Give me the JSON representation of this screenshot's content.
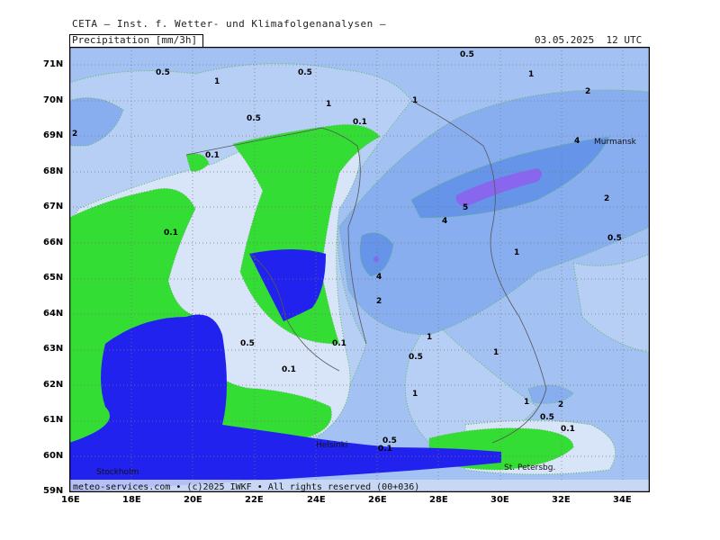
{
  "header": {
    "title": "CETA — Inst. f. Wetter- und Klimafolgenanalysen —",
    "parameter": "Precipitation [mm/3h]",
    "valid_time": "03.05.2025  12 UTC"
  },
  "footer": {
    "credit": "meteo-services.com • (c)2025 IWKF • All rights reserved (00+036)"
  },
  "axes": {
    "lat_labels": [
      "71N",
      "70N",
      "69N",
      "68N",
      "67N",
      "66N",
      "65N",
      "64N",
      "63N",
      "62N",
      "61N",
      "60N",
      "59N"
    ],
    "lon_labels": [
      "16E",
      "18E",
      "20E",
      "22E",
      "24E",
      "26E",
      "28E",
      "30E",
      "32E",
      "34E"
    ]
  },
  "cities": {
    "murmansk": "Murmansk",
    "helsinki": "Helsinki",
    "stockholm": "Stockholm",
    "st_petersburg": "St. Petersbg."
  },
  "contour_labels": {
    "c1": "0.5",
    "c2": "1",
    "c3": "0.5",
    "c4": "1",
    "c5": "0.5",
    "c6": "1",
    "c7": "2",
    "c8": "0.5",
    "c9": "1",
    "c10": "2",
    "c11": "0.1",
    "c12": "0.1",
    "c13": "4",
    "c14": "5",
    "c15": "4",
    "c16": "2",
    "c17": "0.1",
    "c18": "0.5",
    "c19": "1",
    "c20": "4",
    "c21": "2",
    "c22": "0.5",
    "c23": "0.1",
    "c24": "1",
    "c25": "0.5",
    "c26": "1",
    "c27": "0.1",
    "c28": "1",
    "c29": "1",
    "c30": "2",
    "c31": "0.5",
    "c32": "0.1",
    "c33": "0.5",
    "c34": "0.1",
    "c35": "1"
  },
  "legend_colors": {
    "ocean_dry": "#2222ee",
    "land_dry": "#33dd33",
    "p0_1": "#d8e4f8",
    "p0_5": "#b8cff5",
    "p1": "#a3c1f2",
    "p2": "#88aef0",
    "p4": "#6694e8",
    "p5": "#8866ee"
  }
}
